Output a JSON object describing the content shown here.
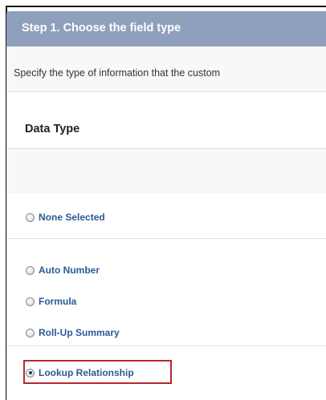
{
  "step": {
    "title": "Step 1. Choose the field type"
  },
  "intro": {
    "text": "Specify the type of information that the custom"
  },
  "data_type": {
    "section_title": "Data Type",
    "options": [
      {
        "label": "None Selected",
        "selected": false
      },
      {
        "label": "Auto Number",
        "selected": false
      },
      {
        "label": "Formula",
        "selected": false
      },
      {
        "label": "Roll-Up Summary",
        "selected": false
      },
      {
        "label": "Lookup Relationship",
        "selected": true
      }
    ]
  },
  "colors": {
    "header_bg": "#8fa0bd",
    "link_blue": "#2a5b94",
    "highlight_red": "#b22a2f"
  }
}
